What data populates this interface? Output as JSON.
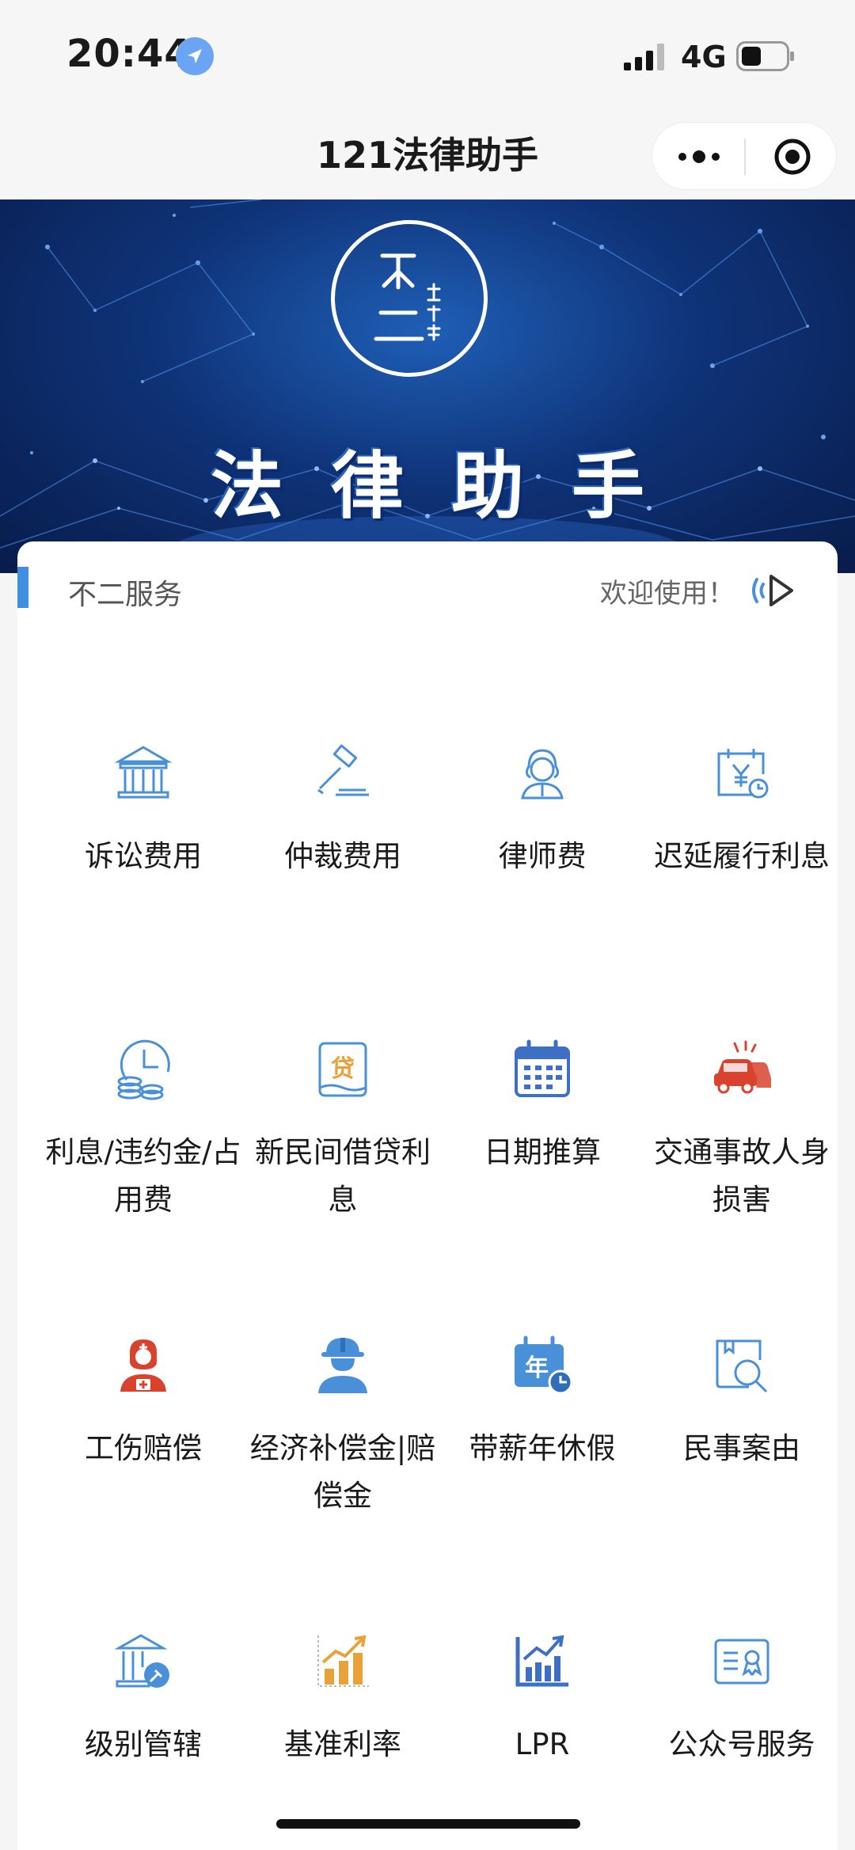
{
  "status_bar": {
    "time": "20:44",
    "network": "4G"
  },
  "nav": {
    "title": "121法律助手"
  },
  "banner": {
    "title": "法律助手"
  },
  "section": {
    "title": "不二服务",
    "welcome": "欢迎使用！"
  },
  "services": [
    {
      "label": "诉讼费用",
      "icon": "courthouse-icon"
    },
    {
      "label": "仲裁费用",
      "icon": "gavel-icon"
    },
    {
      "label": "律师费",
      "icon": "lawyer-icon"
    },
    {
      "label": "迟延履行利息",
      "icon": "calendar-yen-icon"
    },
    {
      "label": "利息/违约金/占用费",
      "icon": "clock-coins-icon"
    },
    {
      "label": "新民间借贷利息",
      "icon": "loan-icon"
    },
    {
      "label": "日期推算",
      "icon": "calendar-icon"
    },
    {
      "label": "交通事故人身损害",
      "icon": "car-crash-icon"
    },
    {
      "label": "工伤赔偿",
      "icon": "injury-worker-icon"
    },
    {
      "label": "经济补偿金|赔偿金",
      "icon": "construction-worker-icon"
    },
    {
      "label": "带薪年休假",
      "icon": "annual-leave-icon"
    },
    {
      "label": "民事案由",
      "icon": "book-search-icon"
    },
    {
      "label": "级别管辖",
      "icon": "jurisdiction-icon"
    },
    {
      "label": "基准利率",
      "icon": "rate-chart-icon"
    },
    {
      "label": "LPR",
      "icon": "lpr-chart-icon"
    },
    {
      "label": "公众号服务",
      "icon": "certificate-icon"
    }
  ],
  "colors": {
    "accent": "#3f8ee0",
    "icon_blue": "#4a90d9",
    "icon_red": "#d9432e",
    "icon_gold": "#e8a23a"
  }
}
